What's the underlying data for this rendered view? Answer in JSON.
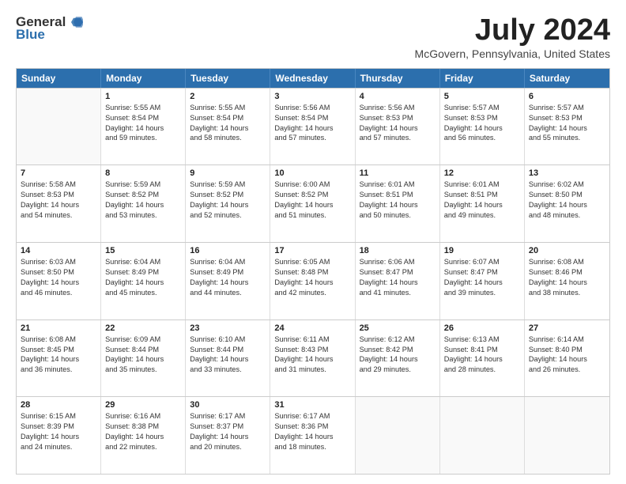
{
  "logo": {
    "general": "General",
    "blue": "Blue"
  },
  "title": "July 2024",
  "location": "McGovern, Pennsylvania, United States",
  "days_of_week": [
    "Sunday",
    "Monday",
    "Tuesday",
    "Wednesday",
    "Thursday",
    "Friday",
    "Saturday"
  ],
  "weeks": [
    [
      {
        "day": "",
        "sunrise": "",
        "sunset": "",
        "daylight": "",
        "empty": true
      },
      {
        "day": "1",
        "sunrise": "Sunrise: 5:55 AM",
        "sunset": "Sunset: 8:54 PM",
        "daylight": "Daylight: 14 hours and 59 minutes.",
        "empty": false
      },
      {
        "day": "2",
        "sunrise": "Sunrise: 5:55 AM",
        "sunset": "Sunset: 8:54 PM",
        "daylight": "Daylight: 14 hours and 58 minutes.",
        "empty": false
      },
      {
        "day": "3",
        "sunrise": "Sunrise: 5:56 AM",
        "sunset": "Sunset: 8:54 PM",
        "daylight": "Daylight: 14 hours and 57 minutes.",
        "empty": false
      },
      {
        "day": "4",
        "sunrise": "Sunrise: 5:56 AM",
        "sunset": "Sunset: 8:53 PM",
        "daylight": "Daylight: 14 hours and 57 minutes.",
        "empty": false
      },
      {
        "day": "5",
        "sunrise": "Sunrise: 5:57 AM",
        "sunset": "Sunset: 8:53 PM",
        "daylight": "Daylight: 14 hours and 56 minutes.",
        "empty": false
      },
      {
        "day": "6",
        "sunrise": "Sunrise: 5:57 AM",
        "sunset": "Sunset: 8:53 PM",
        "daylight": "Daylight: 14 hours and 55 minutes.",
        "empty": false
      }
    ],
    [
      {
        "day": "7",
        "sunrise": "Sunrise: 5:58 AM",
        "sunset": "Sunset: 8:53 PM",
        "daylight": "Daylight: 14 hours and 54 minutes.",
        "empty": false
      },
      {
        "day": "8",
        "sunrise": "Sunrise: 5:59 AM",
        "sunset": "Sunset: 8:52 PM",
        "daylight": "Daylight: 14 hours and 53 minutes.",
        "empty": false
      },
      {
        "day": "9",
        "sunrise": "Sunrise: 5:59 AM",
        "sunset": "Sunset: 8:52 PM",
        "daylight": "Daylight: 14 hours and 52 minutes.",
        "empty": false
      },
      {
        "day": "10",
        "sunrise": "Sunrise: 6:00 AM",
        "sunset": "Sunset: 8:52 PM",
        "daylight": "Daylight: 14 hours and 51 minutes.",
        "empty": false
      },
      {
        "day": "11",
        "sunrise": "Sunrise: 6:01 AM",
        "sunset": "Sunset: 8:51 PM",
        "daylight": "Daylight: 14 hours and 50 minutes.",
        "empty": false
      },
      {
        "day": "12",
        "sunrise": "Sunrise: 6:01 AM",
        "sunset": "Sunset: 8:51 PM",
        "daylight": "Daylight: 14 hours and 49 minutes.",
        "empty": false
      },
      {
        "day": "13",
        "sunrise": "Sunrise: 6:02 AM",
        "sunset": "Sunset: 8:50 PM",
        "daylight": "Daylight: 14 hours and 48 minutes.",
        "empty": false
      }
    ],
    [
      {
        "day": "14",
        "sunrise": "Sunrise: 6:03 AM",
        "sunset": "Sunset: 8:50 PM",
        "daylight": "Daylight: 14 hours and 46 minutes.",
        "empty": false
      },
      {
        "day": "15",
        "sunrise": "Sunrise: 6:04 AM",
        "sunset": "Sunset: 8:49 PM",
        "daylight": "Daylight: 14 hours and 45 minutes.",
        "empty": false
      },
      {
        "day": "16",
        "sunrise": "Sunrise: 6:04 AM",
        "sunset": "Sunset: 8:49 PM",
        "daylight": "Daylight: 14 hours and 44 minutes.",
        "empty": false
      },
      {
        "day": "17",
        "sunrise": "Sunrise: 6:05 AM",
        "sunset": "Sunset: 8:48 PM",
        "daylight": "Daylight: 14 hours and 42 minutes.",
        "empty": false
      },
      {
        "day": "18",
        "sunrise": "Sunrise: 6:06 AM",
        "sunset": "Sunset: 8:47 PM",
        "daylight": "Daylight: 14 hours and 41 minutes.",
        "empty": false
      },
      {
        "day": "19",
        "sunrise": "Sunrise: 6:07 AM",
        "sunset": "Sunset: 8:47 PM",
        "daylight": "Daylight: 14 hours and 39 minutes.",
        "empty": false
      },
      {
        "day": "20",
        "sunrise": "Sunrise: 6:08 AM",
        "sunset": "Sunset: 8:46 PM",
        "daylight": "Daylight: 14 hours and 38 minutes.",
        "empty": false
      }
    ],
    [
      {
        "day": "21",
        "sunrise": "Sunrise: 6:08 AM",
        "sunset": "Sunset: 8:45 PM",
        "daylight": "Daylight: 14 hours and 36 minutes.",
        "empty": false
      },
      {
        "day": "22",
        "sunrise": "Sunrise: 6:09 AM",
        "sunset": "Sunset: 8:44 PM",
        "daylight": "Daylight: 14 hours and 35 minutes.",
        "empty": false
      },
      {
        "day": "23",
        "sunrise": "Sunrise: 6:10 AM",
        "sunset": "Sunset: 8:44 PM",
        "daylight": "Daylight: 14 hours and 33 minutes.",
        "empty": false
      },
      {
        "day": "24",
        "sunrise": "Sunrise: 6:11 AM",
        "sunset": "Sunset: 8:43 PM",
        "daylight": "Daylight: 14 hours and 31 minutes.",
        "empty": false
      },
      {
        "day": "25",
        "sunrise": "Sunrise: 6:12 AM",
        "sunset": "Sunset: 8:42 PM",
        "daylight": "Daylight: 14 hours and 29 minutes.",
        "empty": false
      },
      {
        "day": "26",
        "sunrise": "Sunrise: 6:13 AM",
        "sunset": "Sunset: 8:41 PM",
        "daylight": "Daylight: 14 hours and 28 minutes.",
        "empty": false
      },
      {
        "day": "27",
        "sunrise": "Sunrise: 6:14 AM",
        "sunset": "Sunset: 8:40 PM",
        "daylight": "Daylight: 14 hours and 26 minutes.",
        "empty": false
      }
    ],
    [
      {
        "day": "28",
        "sunrise": "Sunrise: 6:15 AM",
        "sunset": "Sunset: 8:39 PM",
        "daylight": "Daylight: 14 hours and 24 minutes.",
        "empty": false
      },
      {
        "day": "29",
        "sunrise": "Sunrise: 6:16 AM",
        "sunset": "Sunset: 8:38 PM",
        "daylight": "Daylight: 14 hours and 22 minutes.",
        "empty": false
      },
      {
        "day": "30",
        "sunrise": "Sunrise: 6:17 AM",
        "sunset": "Sunset: 8:37 PM",
        "daylight": "Daylight: 14 hours and 20 minutes.",
        "empty": false
      },
      {
        "day": "31",
        "sunrise": "Sunrise: 6:17 AM",
        "sunset": "Sunset: 8:36 PM",
        "daylight": "Daylight: 14 hours and 18 minutes.",
        "empty": false
      },
      {
        "day": "",
        "sunrise": "",
        "sunset": "",
        "daylight": "",
        "empty": true
      },
      {
        "day": "",
        "sunrise": "",
        "sunset": "",
        "daylight": "",
        "empty": true
      },
      {
        "day": "",
        "sunrise": "",
        "sunset": "",
        "daylight": "",
        "empty": true
      }
    ]
  ]
}
